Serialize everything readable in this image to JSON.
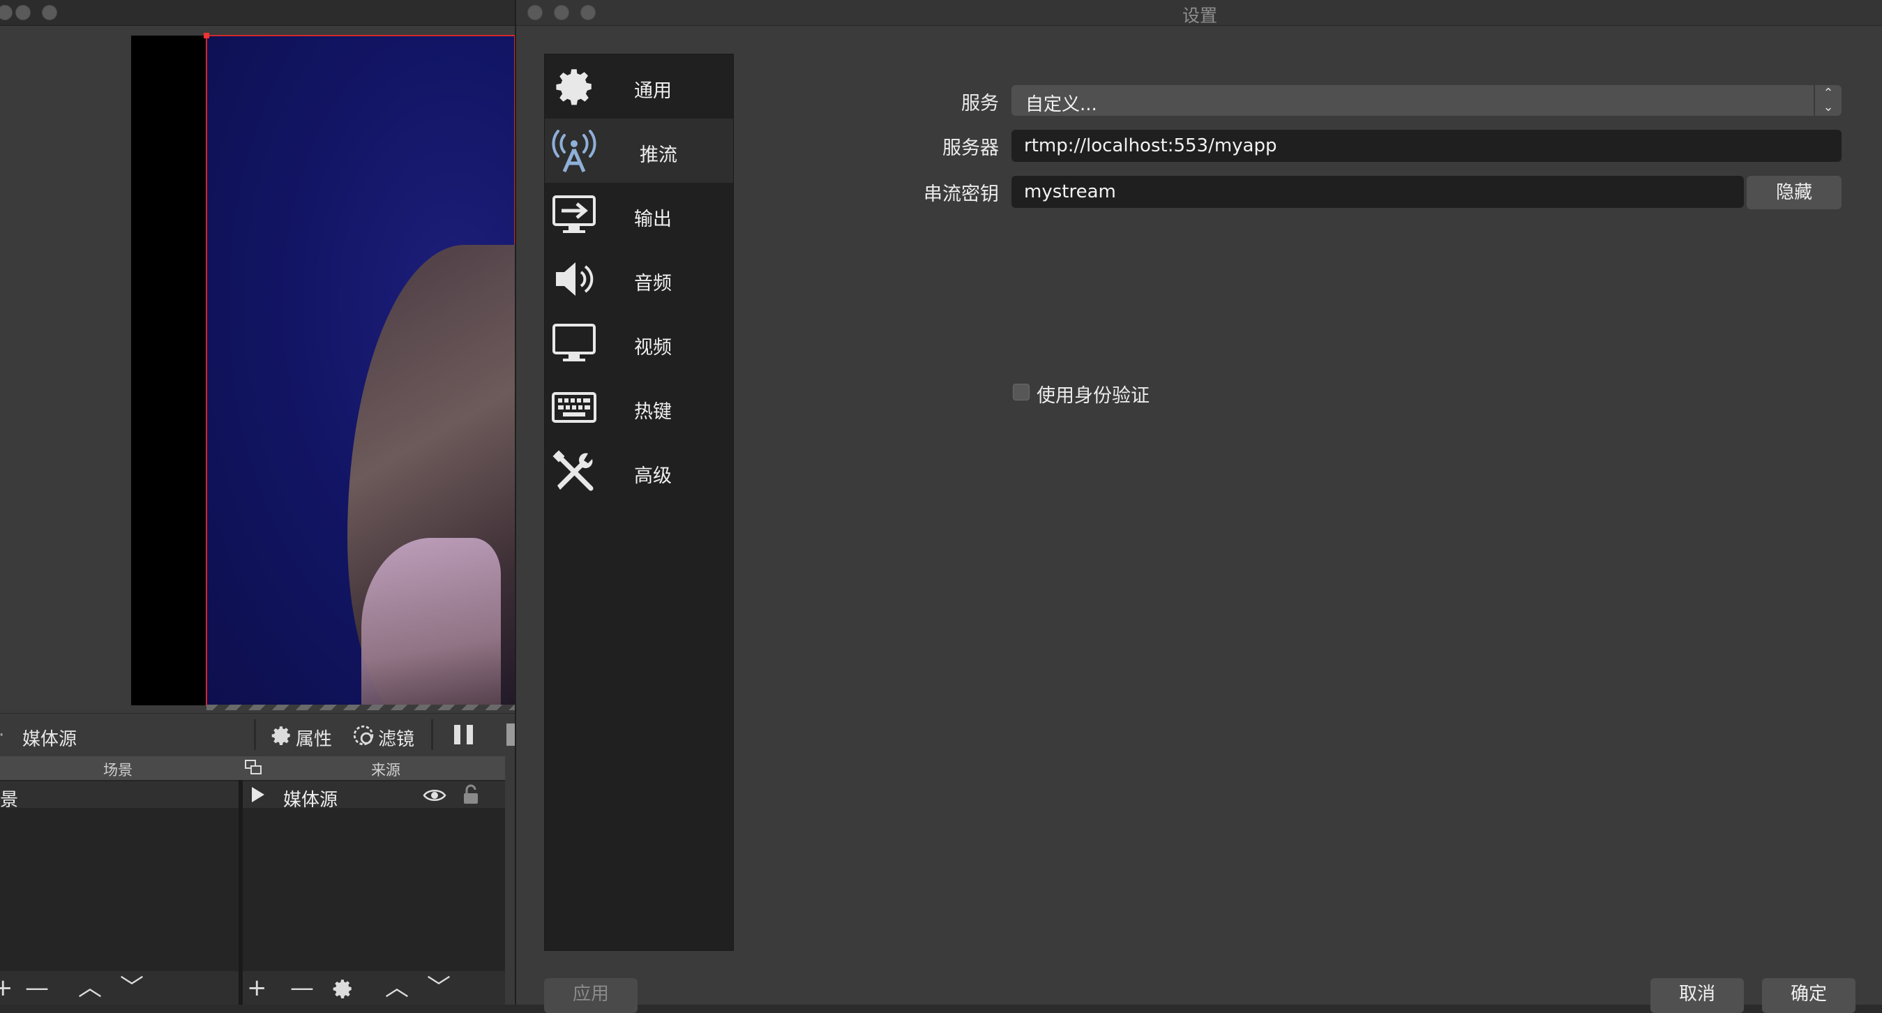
{
  "main_window": {
    "source_toolbar": {
      "current_source": "媒体源",
      "properties_label": "属性",
      "filters_label": "滤镜"
    },
    "docks": {
      "scenes_title": "场景",
      "sources_title": "来源",
      "scenes": [
        "景"
      ],
      "sources": [
        "媒体源"
      ]
    }
  },
  "settings": {
    "title": "设置",
    "categories": [
      {
        "label": "通用",
        "icon": "gear-icon"
      },
      {
        "label": "推流",
        "icon": "broadcast-antenna-icon",
        "selected": true
      },
      {
        "label": "输出",
        "icon": "output-monitor-icon"
      },
      {
        "label": "音频",
        "icon": "speaker-icon"
      },
      {
        "label": "视频",
        "icon": "monitor-icon"
      },
      {
        "label": "热键",
        "icon": "keyboard-icon"
      },
      {
        "label": "高级",
        "icon": "tools-icon"
      }
    ],
    "stream": {
      "service_label": "服务",
      "service_value": "自定义...",
      "server_label": "服务器",
      "server_value": "rtmp://localhost:553/myapp",
      "key_label": "串流密钥",
      "key_value": "mystream",
      "hide_button": "隐藏",
      "auth_label": "使用身份验证",
      "auth_checked": false
    },
    "buttons": {
      "apply": "应用",
      "cancel": "取消",
      "ok": "确定"
    }
  },
  "colors": {
    "selection_outline": "#d02a2a",
    "preview_background": "#121565"
  }
}
